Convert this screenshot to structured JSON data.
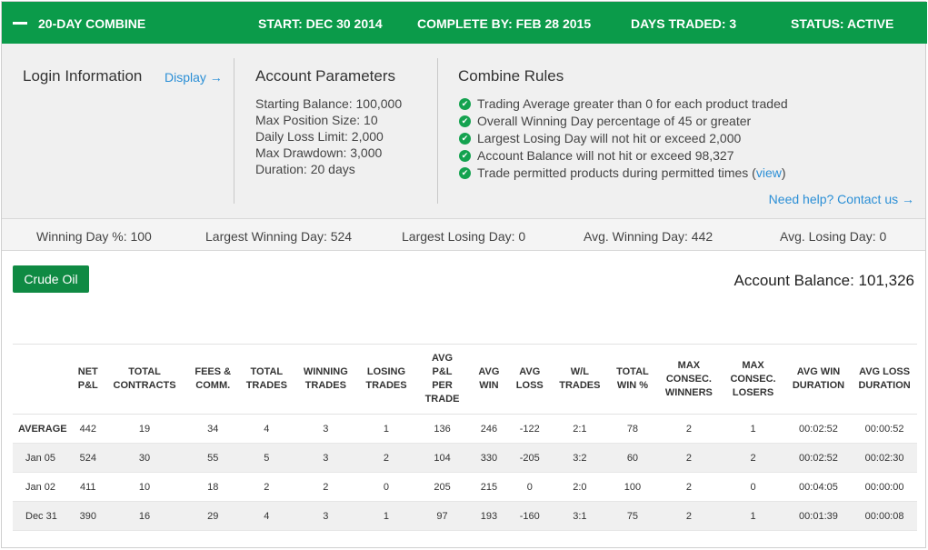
{
  "topbar": {
    "title": "20-DAY COMBINE",
    "start": "START: DEC 30 2014",
    "complete_by": "COMPLETE BY: FEB 28 2015",
    "days_traded": "DAYS TRADED: 3",
    "status": "STATUS: ACTIVE"
  },
  "login": {
    "title": "Login Information",
    "display_link": "Display →"
  },
  "params": {
    "title": "Account Parameters",
    "items": [
      "Starting Balance: 100,000",
      "Max Position Size: 10",
      "Daily Loss Limit: 2,000",
      "Max Drawdown: 3,000",
      "Duration: 20 days"
    ]
  },
  "rules": {
    "title": "Combine Rules",
    "items": [
      "Trading Average greater than 0 for each product traded",
      "Overall Winning Day percentage of 45 or greater",
      "Largest Losing Day will not hit or exceed 2,000",
      "Account Balance will not hit or exceed 98,327"
    ],
    "last_prefix": "Trade permitted products during permitted times (",
    "last_link": "view",
    "last_suffix": ")",
    "help_link": "Need help? Contact us →"
  },
  "stats": {
    "winning_pct": "Winning Day %: 100",
    "largest_win": "Largest Winning Day: 524",
    "largest_loss": "Largest Losing Day: 0",
    "avg_win": "Avg. Winning Day: 442",
    "avg_loss": "Avg. Losing Day: 0"
  },
  "product_button": "Crude Oil",
  "account_balance": "Account Balance: 101,326",
  "table": {
    "headers": [
      [
        "",
        ""
      ],
      [
        "NET",
        "P&L"
      ],
      [
        "TOTAL",
        "CONTRACTS"
      ],
      [
        "FEES &",
        "COMM."
      ],
      [
        "TOTAL",
        "TRADES"
      ],
      [
        "WINNING",
        "TRADES"
      ],
      [
        "LOSING",
        "TRADES"
      ],
      [
        "AVG",
        "P&L",
        "PER",
        "TRADE"
      ],
      [
        "AVG",
        "WIN"
      ],
      [
        "AVG",
        "LOSS"
      ],
      [
        "W/L",
        "TRADES"
      ],
      [
        "TOTAL",
        "WIN %"
      ],
      [
        "MAX",
        "CONSEC.",
        "WINNERS"
      ],
      [
        "MAX",
        "CONSEC.",
        "LOSERS"
      ],
      [
        "AVG WIN",
        "DURATION"
      ],
      [
        "AVG LOSS",
        "DURATION"
      ]
    ],
    "rows": [
      [
        "AVERAGE",
        "442",
        "19",
        "34",
        "4",
        "3",
        "1",
        "136",
        "246",
        "-122",
        "2:1",
        "78",
        "2",
        "1",
        "00:02:52",
        "00:00:52"
      ],
      [
        "Jan 05",
        "524",
        "30",
        "55",
        "5",
        "3",
        "2",
        "104",
        "330",
        "-205",
        "3:2",
        "60",
        "2",
        "2",
        "00:02:52",
        "00:02:30"
      ],
      [
        "Jan 02",
        "411",
        "10",
        "18",
        "2",
        "2",
        "0",
        "205",
        "215",
        "0",
        "2:0",
        "100",
        "2",
        "0",
        "00:04:05",
        "00:00:00"
      ],
      [
        "Dec 31",
        "390",
        "16",
        "29",
        "4",
        "3",
        "1",
        "97",
        "193",
        "-160",
        "3:1",
        "75",
        "2",
        "1",
        "00:01:39",
        "00:00:08"
      ]
    ]
  }
}
